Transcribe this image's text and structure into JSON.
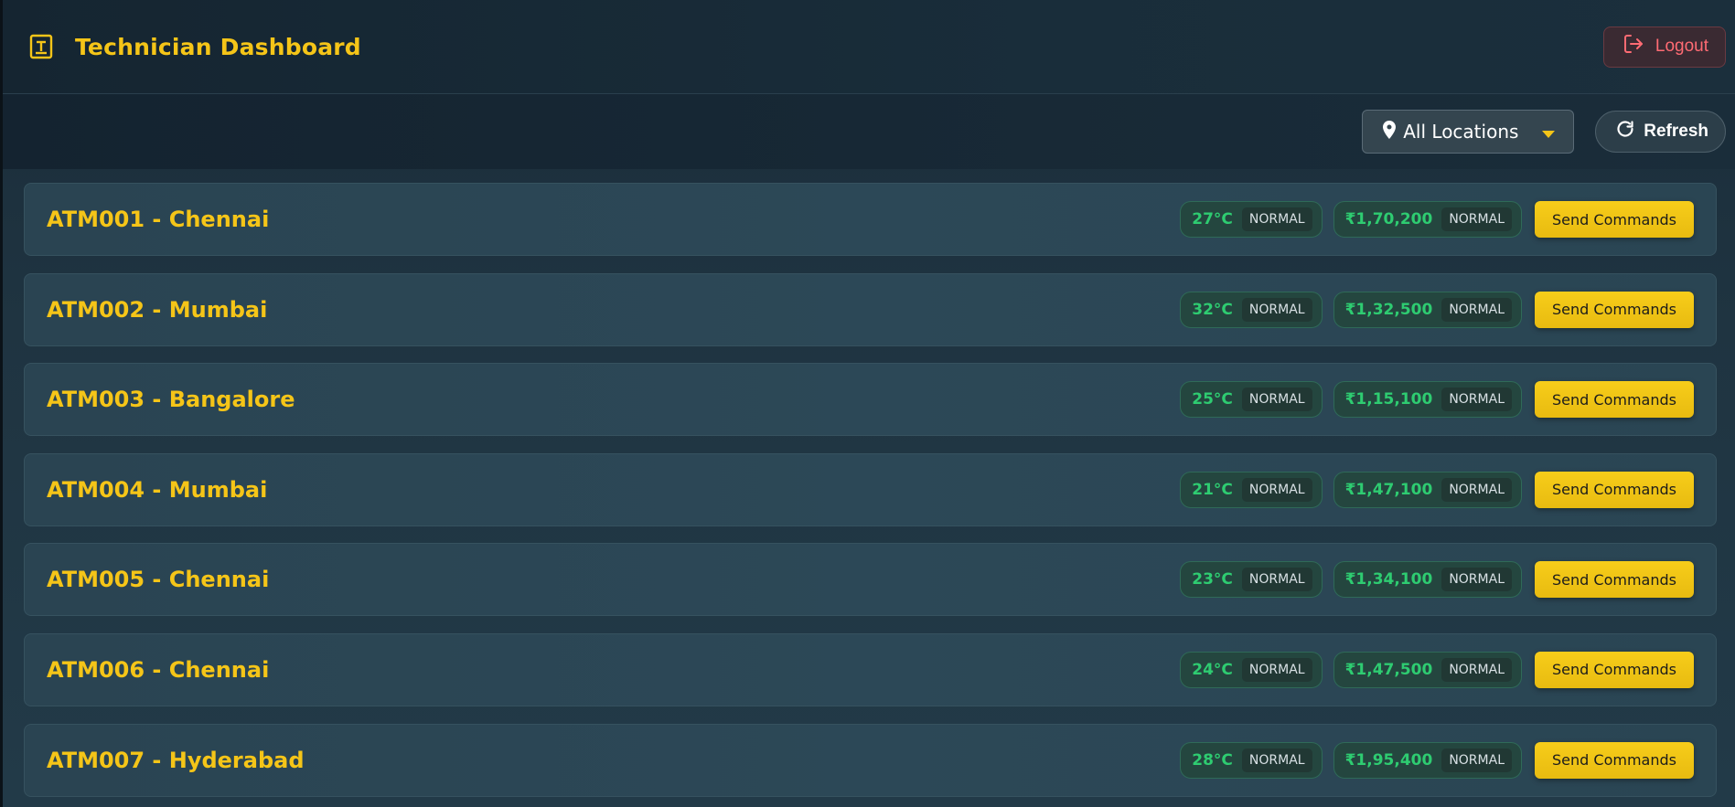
{
  "header": {
    "title": "Technician Dashboard",
    "logout_label": "Logout"
  },
  "toolbar": {
    "location_selected": "All Locations",
    "refresh_label": "Refresh"
  },
  "atms": [
    {
      "name": "ATM001 - Chennai",
      "temp": "27°C",
      "temp_status": "NORMAL",
      "cash": "₹1,70,200",
      "cash_status": "NORMAL",
      "action": "Send Commands"
    },
    {
      "name": "ATM002 - Mumbai",
      "temp": "32°C",
      "temp_status": "NORMAL",
      "cash": "₹1,32,500",
      "cash_status": "NORMAL",
      "action": "Send Commands"
    },
    {
      "name": "ATM003 - Bangalore",
      "temp": "25°C",
      "temp_status": "NORMAL",
      "cash": "₹1,15,100",
      "cash_status": "NORMAL",
      "action": "Send Commands"
    },
    {
      "name": "ATM004 - Mumbai",
      "temp": "21°C",
      "temp_status": "NORMAL",
      "cash": "₹1,47,100",
      "cash_status": "NORMAL",
      "action": "Send Commands"
    },
    {
      "name": "ATM005 - Chennai",
      "temp": "23°C",
      "temp_status": "NORMAL",
      "cash": "₹1,34,100",
      "cash_status": "NORMAL",
      "action": "Send Commands"
    },
    {
      "name": "ATM006 - Chennai",
      "temp": "24°C",
      "temp_status": "NORMAL",
      "cash": "₹1,47,500",
      "cash_status": "NORMAL",
      "action": "Send Commands"
    },
    {
      "name": "ATM007 - Hyderabad",
      "temp": "28°C",
      "temp_status": "NORMAL",
      "cash": "₹1,95,400",
      "cash_status": "NORMAL",
      "action": "Send Commands"
    }
  ],
  "icons": {
    "brand": "terminal-icon",
    "logout": "logout-icon",
    "location": "map-pin-icon",
    "dropdown": "caret-down-icon",
    "refresh": "refresh-icon"
  },
  "colors": {
    "accent": "#f5c518",
    "ok": "#2ecc71",
    "danger": "#ff6b73"
  }
}
